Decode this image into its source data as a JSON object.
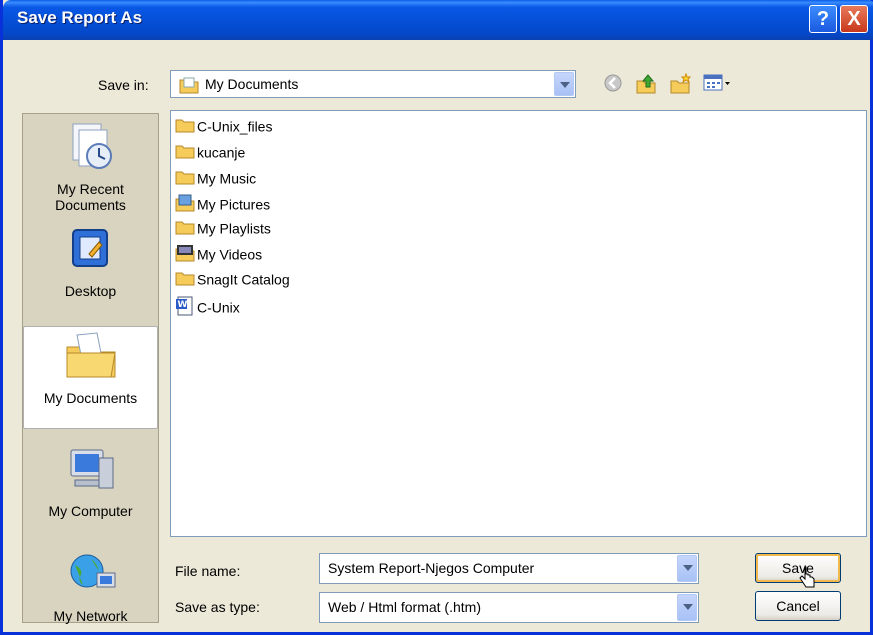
{
  "dialog": {
    "title": "Save Report As",
    "help_label": "?",
    "close_label": "X"
  },
  "save_in": {
    "label": "Save in:",
    "value": "My Documents"
  },
  "places": [
    {
      "label_line1": "My Recent",
      "label_line2": "Documents"
    },
    {
      "label_line1": "Desktop"
    },
    {
      "label_line1": "My Documents"
    },
    {
      "label_line1": "My Computer"
    },
    {
      "label_line1": "My Network"
    }
  ],
  "files": [
    {
      "name": "C-Unix_files",
      "icon": "folder-icon"
    },
    {
      "name": "kucanje",
      "icon": "folder-icon"
    },
    {
      "name": "My Music",
      "icon": "folder-icon"
    },
    {
      "name": "My Pictures",
      "icon": "pictures-folder-icon"
    },
    {
      "name": "My Playlists",
      "icon": "folder-icon"
    },
    {
      "name": "My Videos",
      "icon": "videos-folder-icon"
    },
    {
      "name": "SnagIt Catalog",
      "icon": "folder-icon"
    },
    {
      "name": "C-Unix",
      "icon": "word-document-icon"
    }
  ],
  "filename": {
    "label": "File name:",
    "value": "System Report-Njegos Computer"
  },
  "filetype": {
    "label": "Save as type:",
    "value": "Web / Html format (.htm)"
  },
  "buttons": {
    "save": "Save",
    "cancel": "Cancel"
  },
  "colors": {
    "titlebar": "#0550d8",
    "dialog_bg": "#ece9d8",
    "folder": "#f5cc5a"
  }
}
